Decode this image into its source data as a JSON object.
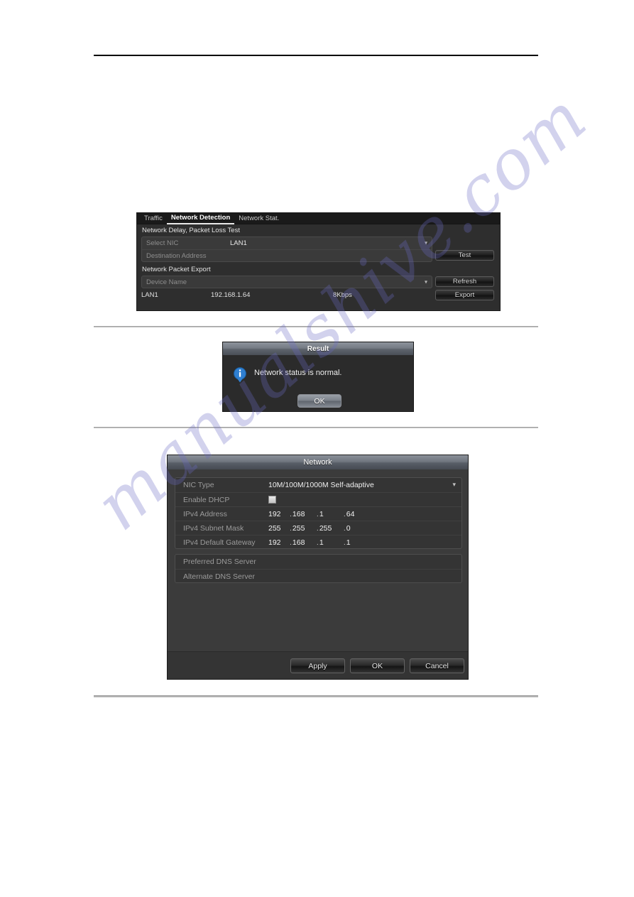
{
  "page": {
    "background_color": "#ffffff",
    "watermark_text": "manualshive.com",
    "watermark_color": "#6a6ac4"
  },
  "detection_panel": {
    "tabs": [
      {
        "label": "Traffic",
        "active": false
      },
      {
        "label": "Network Detection",
        "active": true
      },
      {
        "label": "Network Stat.",
        "active": false
      }
    ],
    "section_delay_title": "Network Delay, Packet Loss Test",
    "select_nic_label": "Select NIC",
    "select_nic_value": "LAN1",
    "destination_address_label": "Destination Address",
    "destination_address_value": "",
    "section_export_title": "Network Packet Export",
    "device_name_label": "Device Name",
    "device_name_value": "",
    "lan_row": {
      "name": "LAN1",
      "ip": "192.168.1.64",
      "bandwidth": "8Kbps"
    },
    "buttons": {
      "test": "Test",
      "refresh": "Refresh",
      "export": "Export"
    }
  },
  "result_dialog": {
    "title": "Result",
    "message": "Network status is normal.",
    "ok_label": "OK",
    "icon": "info-icon",
    "icon_color": "#2f7fd0"
  },
  "network_dialog": {
    "title": "Network",
    "rows": {
      "nic_type_label": "NIC Type",
      "nic_type_value": "10M/100M/1000M Self-adaptive",
      "enable_dhcp_label": "Enable DHCP",
      "enable_dhcp_checked": false,
      "ipv4_address_label": "IPv4 Address",
      "ipv4_address": [
        "192",
        "168",
        "1",
        "64"
      ],
      "ipv4_subnet_label": "IPv4 Subnet Mask",
      "ipv4_subnet": [
        "255",
        "255",
        "255",
        "0"
      ],
      "ipv4_gateway_label": "IPv4 Default Gateway",
      "ipv4_gateway": [
        "192",
        "168",
        "1",
        "1"
      ],
      "preferred_dns_label": "Preferred DNS Server",
      "preferred_dns_value": "",
      "alternate_dns_label": "Alternate DNS Server",
      "alternate_dns_value": ""
    },
    "buttons": {
      "apply": "Apply",
      "ok": "OK",
      "cancel": "Cancel"
    }
  }
}
